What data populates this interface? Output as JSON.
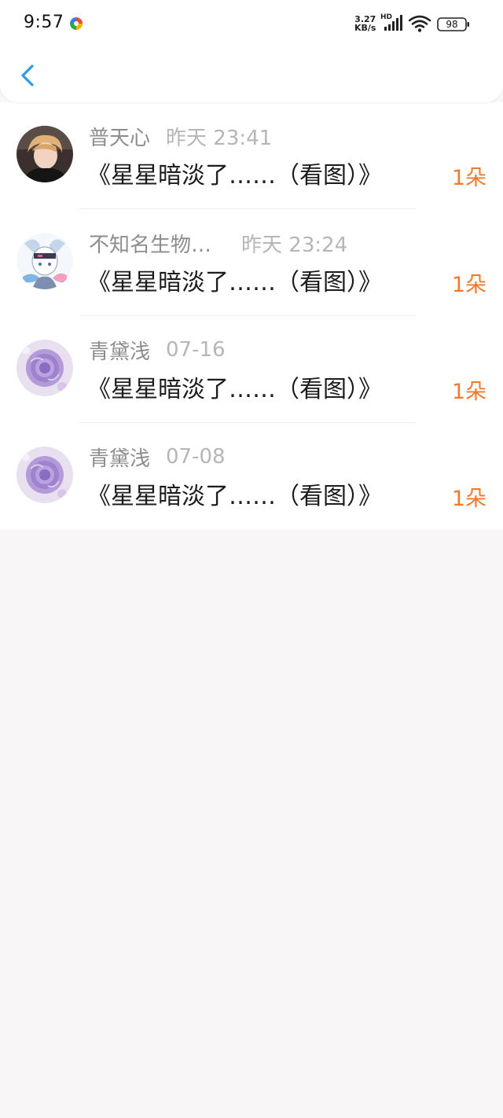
{
  "status_bar": {
    "time": "9:57",
    "net_speed_value": "3.27",
    "net_speed_unit": "KB/s",
    "hd_label": "HD",
    "battery": "98"
  },
  "header": {
    "back_icon": "chevron-left-icon"
  },
  "colors": {
    "accent": "#2a9ce8",
    "count": "#ef7a2e",
    "name": "#8d8d8d",
    "time": "#b6b6b6",
    "title": "#1c1c1c",
    "background": "#f8f6f7"
  },
  "records": [
    {
      "name": "普天心",
      "time": "昨天 23:41",
      "title": "《星星暗淡了……（看图）》",
      "count": "1朵"
    },
    {
      "name": "不知名生物…",
      "time": "昨天 23:24",
      "title": "《星星暗淡了……（看图）》",
      "count": "1朵"
    },
    {
      "name": "青黛浅",
      "time": "07-16",
      "title": "《星星暗淡了……（看图）》",
      "count": "1朵"
    },
    {
      "name": "青黛浅",
      "time": "07-08",
      "title": "《星星暗淡了……（看图）》",
      "count": "1朵"
    }
  ]
}
